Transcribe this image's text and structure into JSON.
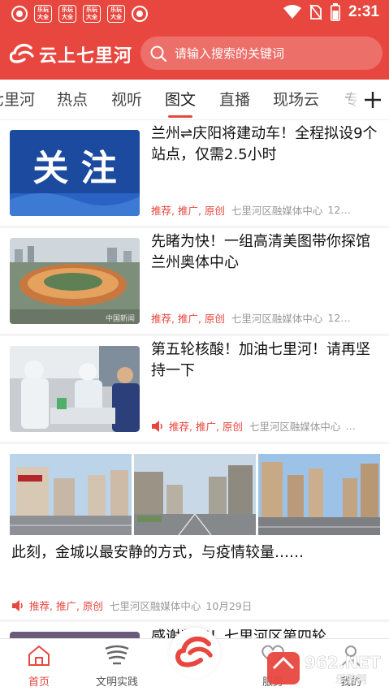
{
  "status_bar": {
    "badges": [
      "乐玩大全",
      "乐玩大全",
      "乐玩大全",
      "乐玩大全"
    ],
    "time": "2:31"
  },
  "header": {
    "logo_text": "云上七里河",
    "search_placeholder": "请输入搜索的关键词"
  },
  "tabs": {
    "items": [
      "七里河",
      "热点",
      "视听",
      "图文",
      "直播",
      "现场云",
      "专题"
    ],
    "active": "图文"
  },
  "feed": {
    "articles": [
      {
        "title": "兰州⇌庆阳将建动车！全程拟设9个站点，仅需2.5小时",
        "tags": "推荐, 推广, 原创",
        "source": "七里河区融媒体中心",
        "time": "12…",
        "thumb_text": "关 注"
      },
      {
        "title": "先睹为快！一组高清美图带你探馆兰州奥体中心",
        "tags": "推荐, 推广, 原创",
        "source": "七里河区融媒体中心",
        "time": "12…",
        "thumb_text": "中国新闻"
      },
      {
        "title": "第五轮核酸！加油七里河！请再坚持一下",
        "tags": "推荐, 推广, 原创",
        "source": "七里河区融媒体中心",
        "time": "…"
      },
      {
        "title": "此刻，金城以最安静的方式，与疫情较量……",
        "tags": "推荐, 推广, 原创",
        "source": "七里河区融媒体中心",
        "time": "10月29日"
      },
      {
        "title": "感谢坚守！七里河区第四轮"
      }
    ]
  },
  "bottom_nav": {
    "items": [
      "首页",
      "文明实践",
      "服务",
      "我的"
    ]
  },
  "watermark": {
    "text": "962.NET",
    "sub": "乐游网"
  },
  "colors": {
    "brand": "#e8473f",
    "tag_red": "#e8473f",
    "meta_gray": "#999999"
  }
}
